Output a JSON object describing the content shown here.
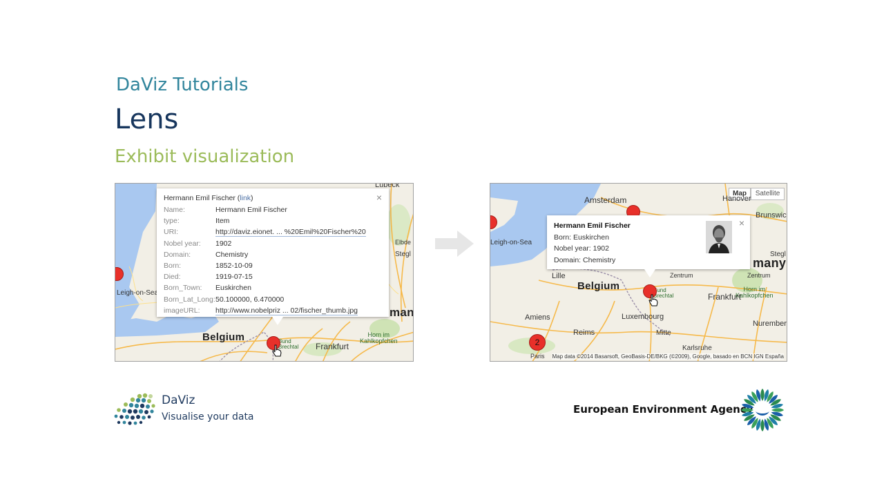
{
  "slide": {
    "series_title": "DaViz Tutorials",
    "title": "Lens",
    "subtitle": "Exhibit visualization"
  },
  "left_map": {
    "popup": {
      "heading_name": "Hermann Emil Fischer",
      "heading_link": "link",
      "close": "×",
      "fields": [
        {
          "key": "Name:",
          "value": "Hermann Emil Fischer"
        },
        {
          "key": "type:",
          "value": "Item"
        },
        {
          "key": "URI:",
          "value": "http://daviz.eionet. ... %20Emil%20Fischer%20"
        },
        {
          "key": "Nobel year:",
          "value": "1902"
        },
        {
          "key": "Domain:",
          "value": "Chemistry"
        },
        {
          "key": "Born:",
          "value": "1852-10-09"
        },
        {
          "key": "Died:",
          "value": "1919-07-15"
        },
        {
          "key": "Born_Town:",
          "value": "Euskirchen"
        },
        {
          "key": "Born_Lat_Long:",
          "value": "50.100000, 6.470000"
        },
        {
          "key": "imageURL:",
          "value": "http://www.nobelpriz ... 02/fischer_thumb.jpg"
        }
      ]
    },
    "labels": {
      "lubeck": "Lübeck",
      "leigh": "Leigh-on-Sea",
      "belgium": "Belgium",
      "frankfurt": "Frankfurt",
      "many": "many",
      "elbde": "Elbde",
      "stegl": "Stegl",
      "horn": "Horn im\nKahlkopfchen",
      "bund": "Bund\nBrechtal"
    }
  },
  "right_map": {
    "map_type": {
      "map": "Map",
      "satellite": "Satellite"
    },
    "popup": {
      "name": "Hermann Emil Fischer",
      "born": "Born: Euskirchen",
      "nobel_year": "Nobel year: 1902",
      "domain": "Domain: Chemistry",
      "close": "×"
    },
    "labels": {
      "amsterdam": "Amsterdam",
      "hanover": "Hanover",
      "brunswick": "Brunswick",
      "leigh": "Leigh-on-Sea",
      "belgium": "Belgium",
      "lille": "Lille",
      "amiens": "Amiens",
      "reims": "Reims",
      "luxembourg": "Luxembourg",
      "mitte": "Mitte",
      "frankfurt": "Frankfurt",
      "nuremberg": "Nuremberg",
      "karlsruhe": "Karlsruhe",
      "many": "many",
      "zentrum1": "Zentrum",
      "zentrum2": "Zentrum",
      "stegl": "Stegl",
      "horn": "Horn im\nKahlkopfchen",
      "bund": "Bund\nBrechtal",
      "paris": "Paris"
    },
    "cluster_count": "2",
    "attribution": "Map data ©2014 Basarsoft, GeoBasis-DE/BKG (©2009), Google, basado en BCN IGN España"
  },
  "footer": {
    "daviz_name": "DaViz",
    "daviz_tagline": "Visualise your data",
    "eea_name": "European Environment Agency"
  },
  "colors": {
    "series_title": "#31859c",
    "title": "#17365d",
    "subtitle": "#9bbb59",
    "marker": "#e8302a",
    "sea": "#a9c8f0",
    "land": "#f2efe6"
  },
  "icons": [
    "close-icon",
    "map-marker-icon",
    "hand-cursor-icon",
    "arrow-right-icon",
    "daviz-logo",
    "eea-logo"
  ]
}
